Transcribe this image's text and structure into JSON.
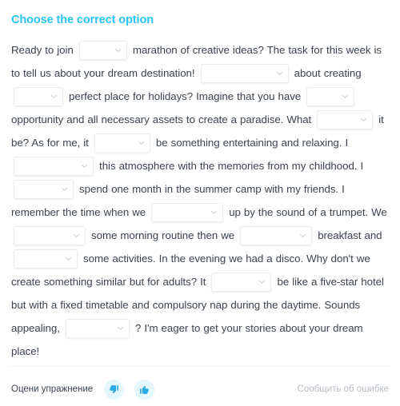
{
  "exercise": {
    "title": "Choose the correct option",
    "segments": [
      {
        "type": "text",
        "value": "Ready to join "
      },
      {
        "type": "gap",
        "id": "gap-1",
        "value": "",
        "width": "w60"
      },
      {
        "type": "text",
        "value": " marathon of creative ideas? The task for this week is to tell us about your dream destination! "
      },
      {
        "type": "gap",
        "id": "gap-2",
        "value": "",
        "width": "w110"
      },
      {
        "type": "text",
        "value": " about creating "
      },
      {
        "type": "gap",
        "id": "gap-3",
        "value": "",
        "width": "w62"
      },
      {
        "type": "text",
        "value": " perfect place for holidays? Imagine that you have "
      },
      {
        "type": "gap",
        "id": "gap-4",
        "value": "",
        "width": "w60"
      },
      {
        "type": "text",
        "value": " opportunity and all necessary assets to create a paradise. What "
      },
      {
        "type": "gap",
        "id": "gap-5",
        "value": "",
        "width": "w70"
      },
      {
        "type": "text",
        "value": " it be? As for me, it "
      },
      {
        "type": "gap",
        "id": "gap-6",
        "value": "",
        "width": "w70"
      },
      {
        "type": "text",
        "value": " be something entertaining and relaxing. I "
      },
      {
        "type": "gap",
        "id": "gap-7",
        "value": "",
        "width": "w100"
      },
      {
        "type": "text",
        "value": " this atmosphere with the memories from my childhood. I "
      },
      {
        "type": "gap",
        "id": "gap-8",
        "value": "",
        "width": "w75"
      },
      {
        "type": "text",
        "value": " spend one month in the summer camp with my friends. I remember the time when we "
      },
      {
        "type": "gap",
        "id": "gap-9",
        "value": "",
        "width": "w90"
      },
      {
        "type": "text",
        "value": " up by the sound of a trumpet. We "
      },
      {
        "type": "gap",
        "id": "gap-10",
        "value": "",
        "width": "w90"
      },
      {
        "type": "text",
        "value": " some morning routine then we "
      },
      {
        "type": "gap",
        "id": "gap-11",
        "value": "",
        "width": "w90"
      },
      {
        "type": "text",
        "value": " breakfast and "
      },
      {
        "type": "gap",
        "id": "gap-12",
        "value": "",
        "width": "w80"
      },
      {
        "type": "text",
        "value": " some activities. In the evening we had a disco. Why don't we create something similar but for adults? It "
      },
      {
        "type": "gap",
        "id": "gap-13",
        "value": "",
        "width": "w75"
      },
      {
        "type": "text",
        "value": " be like a five-star hotel but with a fixed timetable and compulsory nap during the daytime. Sounds appealing, "
      },
      {
        "type": "gap",
        "id": "gap-14",
        "value": "",
        "width": "w80"
      },
      {
        "type": "text",
        "value": " ? I'm eager to get your stories about your dream place!"
      }
    ]
  },
  "footer": {
    "rate_label": "Оцени упражнение",
    "thumbs_down_icon": "thumbs-down-icon",
    "thumbs_up_icon": "thumbs-up-icon",
    "report_label": "Сообщить об ошибке"
  },
  "colors": {
    "title": "#29c5f6",
    "text": "#3c4450",
    "rate_button_bg": "#e3f7fd",
    "rate_button_glyph": "#29a9e6",
    "report_text": "#b6bcc4",
    "gap_border": "#e9edf1"
  }
}
